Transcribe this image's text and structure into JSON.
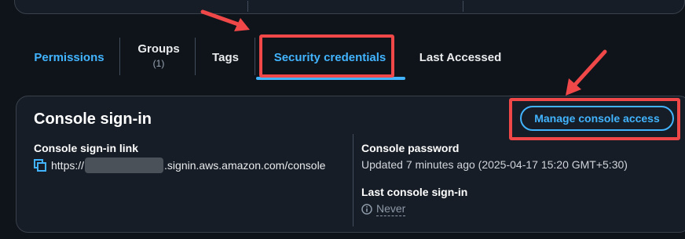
{
  "tabs": [
    {
      "label": "Permissions"
    },
    {
      "label": "Groups",
      "count": "(1)"
    },
    {
      "label": "Tags"
    },
    {
      "label": "Security credentials"
    },
    {
      "label": "Last Accessed"
    }
  ],
  "active_tab": "Security credentials",
  "console_signin": {
    "title": "Console sign-in",
    "manage_button": "Manage console access",
    "link_label": "Console sign-in link",
    "link_prefix": "https://",
    "link_suffix": ".signin.aws.amazon.com/console",
    "password_label": "Console password",
    "password_value": "Updated 7 minutes ago (2025-04-17 15:20 GMT+5:30)",
    "last_signin_label": "Last console sign-in",
    "last_signin_value": "Never"
  },
  "icons": {
    "copy": "copy-icon",
    "info": "info-icon",
    "arrow": "arrow-annotation"
  },
  "colors": {
    "background": "#0f141a",
    "card": "#161d26",
    "accent": "#42b4ff",
    "highlight": "#f04848",
    "text": "#ffffff",
    "muted": "#8d99a8"
  }
}
